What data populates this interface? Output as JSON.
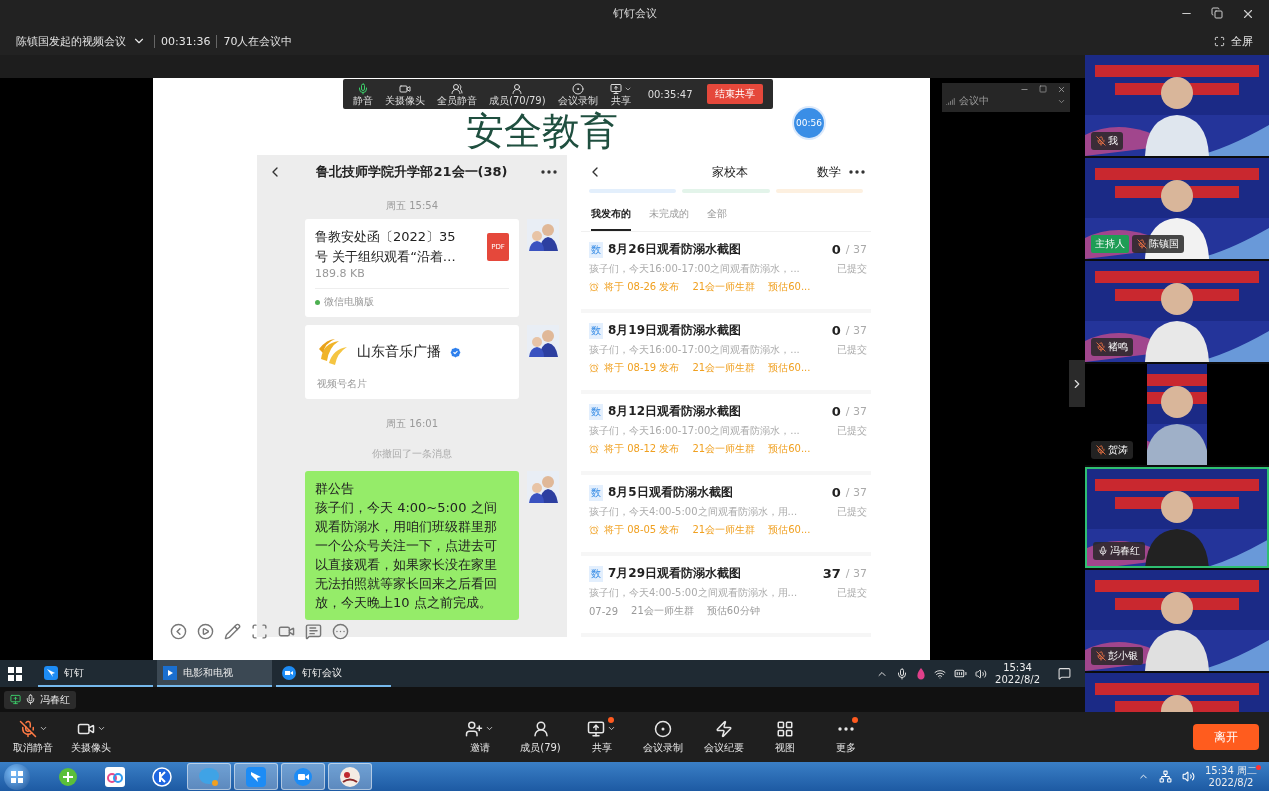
{
  "window": {
    "title": "钉钉会议"
  },
  "meeting_bar": {
    "title": "陈镇国发起的视频会议",
    "duration": "00:31:36",
    "attendance": "70人在会议中",
    "fullscreen": "全屏"
  },
  "shared_screen": {
    "share_toolbar": {
      "buttons": [
        {
          "label": "静音",
          "menu": false
        },
        {
          "label": "关摄像头",
          "menu": false
        },
        {
          "label": "全员静音",
          "menu": false
        },
        {
          "label": "成员(70/79)",
          "menu": false
        },
        {
          "label": "会议录制",
          "menu": false
        },
        {
          "label": "共享",
          "menu": true
        }
      ],
      "timer": "00:35:47",
      "stop": "结束共享"
    },
    "slide_title": "安全教育",
    "timer_badge": "00:56",
    "chat": {
      "title": "鲁北技师学院升学部21会一(38)",
      "messages": [
        {
          "kind": "time",
          "text": "周五 15:54"
        },
        {
          "kind": "file",
          "name": "鲁教安处函〔2022〕35号 关于组织观看“沿着…",
          "size": "189.8 KB",
          "source": "微信电脑版",
          "file_type": "PDF"
        },
        {
          "kind": "card",
          "name": "山东音乐广播",
          "label": "视频号名片",
          "verified": true
        },
        {
          "kind": "time",
          "text": "周五 16:01"
        },
        {
          "kind": "notice",
          "text": "你撤回了一条消息"
        },
        {
          "kind": "text",
          "title": "群公告",
          "body": "孩子们，今天 4:00~5:00 之间观看防溺水，用咱们班级群里那一个公众号关注一下，点进去可以直接观看，如果家长没在家里无法拍照就等家长回来之后看回放，今天晚上10 点之前完成。"
        }
      ]
    },
    "homework": {
      "title": "家校本",
      "subject": "数学",
      "tabs": [
        {
          "label": "我发布的",
          "selected": true
        },
        {
          "label": "未完成的",
          "selected": false
        },
        {
          "label": "全部",
          "selected": false
        }
      ],
      "items": [
        {
          "badge": "数",
          "title": "8月26日观看防溺水截图",
          "done": "0",
          "total": "/ 37",
          "status": "已提交",
          "desc": "孩子们，今天16:00-17:00之间观看防溺水，...",
          "scheduled": true,
          "publish": "将于 08-26 发布",
          "group": "21会一师生群",
          "estimate": "预估60..."
        },
        {
          "badge": "数",
          "title": "8月19日观看防溺水截图",
          "done": "0",
          "total": "/ 37",
          "status": "已提交",
          "desc": "孩子们，今天16:00-17:00之间观看防溺水，...",
          "scheduled": true,
          "publish": "将于 08-19 发布",
          "group": "21会一师生群",
          "estimate": "预估60..."
        },
        {
          "badge": "数",
          "title": "8月12日观看防溺水截图",
          "done": "0",
          "total": "/ 37",
          "status": "已提交",
          "desc": "孩子们，今天16:00-17:00之间观看防溺水，...",
          "scheduled": true,
          "publish": "将于 08-12 发布",
          "group": "21会一师生群",
          "estimate": "预估60..."
        },
        {
          "badge": "数",
          "title": "8月5日观看防溺水截图",
          "done": "0",
          "total": "/ 37",
          "status": "已提交",
          "desc": "孩子们，今天4:00-5:00之间观看防溺水，用...",
          "scheduled": true,
          "publish": "将于 08-05 发布",
          "group": "21会一师生群",
          "estimate": "预估60..."
        },
        {
          "badge": "数",
          "title": "7月29日观看防溺水截图",
          "done": "37",
          "total": "/ 37",
          "status": "已提交",
          "desc": "孩子们，今天4:00-5:00之间观看防溺水，用...",
          "scheduled": false,
          "publish": "07-29",
          "group": "21会一师生群",
          "estimate": "预估60分钟"
        }
      ]
    },
    "mini_window": {
      "status": "会议中"
    },
    "taskbar": {
      "apps": [
        {
          "label": "钉钉",
          "selected": false
        },
        {
          "label": "电影和电视",
          "selected": true
        },
        {
          "label": "钉钉会议",
          "selected": false
        }
      ],
      "time": "15:34",
      "date": "2022/8/2"
    }
  },
  "speaker": {
    "name": "冯春红"
  },
  "participants": [
    {
      "name": "我",
      "muted": true,
      "speaking": false,
      "kind": "full"
    },
    {
      "name": "陈镇国",
      "role": "主持人",
      "muted": true,
      "speaking": false,
      "kind": "full"
    },
    {
      "name": "褚鸣",
      "muted": true,
      "speaking": false,
      "kind": "full"
    },
    {
      "name": "贺涛",
      "muted": true,
      "speaking": false,
      "kind": "narrow"
    },
    {
      "name": "冯春红",
      "muted": false,
      "speaking": true,
      "kind": "full"
    },
    {
      "name": "彭小银",
      "muted": true,
      "speaking": false,
      "kind": "full"
    }
  ],
  "toolbar": {
    "left": [
      {
        "label": "取消静音",
        "menu": true
      },
      {
        "label": "关摄像头",
        "menu": true
      }
    ],
    "center": [
      {
        "label": "邀请",
        "menu": true,
        "dot": false
      },
      {
        "label": "成员(79)",
        "menu": false,
        "dot": false
      },
      {
        "label": "共享",
        "menu": true,
        "dot": true
      },
      {
        "label": "会议录制",
        "menu": false,
        "dot": false
      },
      {
        "label": "会议纪要",
        "menu": false,
        "dot": false
      },
      {
        "label": "视图",
        "menu": false,
        "dot": false
      },
      {
        "label": "更多",
        "menu": false,
        "dot": true
      }
    ],
    "leave": "离开"
  },
  "taskbar": {
    "apps": [
      {
        "running": false
      },
      {
        "running": false
      },
      {
        "running": false
      },
      {
        "running": true
      },
      {
        "running": true
      },
      {
        "running": true
      },
      {
        "running": true
      }
    ],
    "time": "15:34 周二",
    "date": "2022/8/2",
    "notification": true
  }
}
